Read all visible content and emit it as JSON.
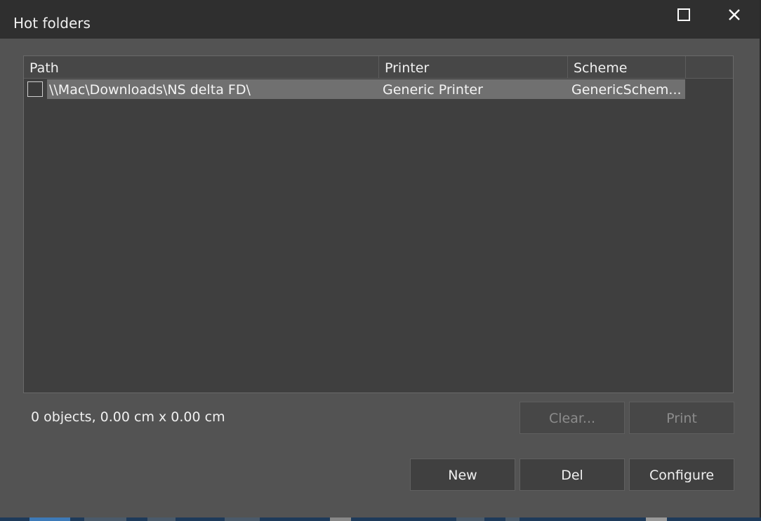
{
  "window": {
    "title": "Hot folders"
  },
  "table": {
    "columns": [
      "Path",
      "Printer",
      "Scheme"
    ],
    "rows": [
      {
        "checked": false,
        "path": "\\\\Mac\\Downloads\\NS delta FD\\",
        "printer": "Generic Printer",
        "scheme": "GenericSchem..."
      }
    ]
  },
  "status": {
    "text": "0 objects, 0.00 cm x 0.00 cm"
  },
  "buttons": {
    "clear": "Clear...",
    "print": "Print",
    "new": "New",
    "del": "Del",
    "configure": "Configure"
  },
  "colors": {
    "titlebar": "#2f2f2f",
    "body": "#535353",
    "table_bg": "#3f3f3f",
    "selection": "#707070"
  }
}
